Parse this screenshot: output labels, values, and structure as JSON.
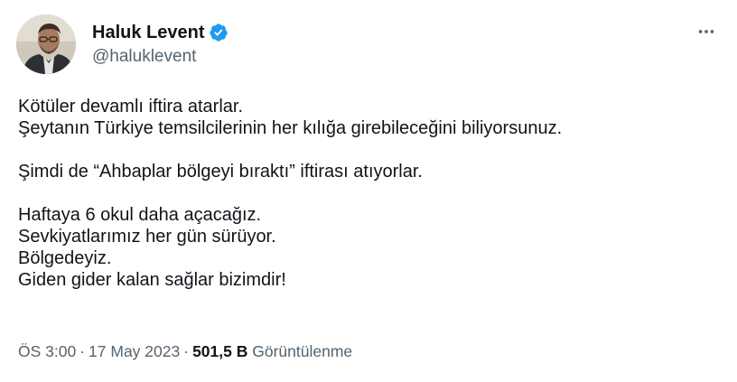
{
  "author": {
    "display_name": "Haluk Levent",
    "handle": "@haluklevent",
    "verified": true,
    "verified_icon": "verified-badge-icon",
    "avatar_icon": "profile-photo"
  },
  "menu": {
    "icon": "more-horizontal-icon"
  },
  "tweet": {
    "lines": [
      "Kötüler devamlı iftira atarlar.",
      "Şeytanın Türkiye temsilcilerinin her kılığa girebileceğini biliyorsunuz.",
      "",
      "Şimdi de “Ahbaplar bölgeyi bıraktı” iftirası atıyorlar.",
      "",
      "Haftaya 6 okul daha açacağız.",
      "Sevkiyatlarımız her gün sürüyor.",
      "Bölgedeyiz.",
      "Giden gider kalan sağlar bizimdir!"
    ]
  },
  "meta": {
    "time": "ÖS 3:00",
    "separator": "·",
    "date": "17 May 2023",
    "views_count": "501,5 B",
    "views_label": "Görüntülenme"
  },
  "colors": {
    "text_primary": "#0f1419",
    "text_secondary": "#536471",
    "verified_blue": "#1d9bf0",
    "background": "#ffffff"
  }
}
